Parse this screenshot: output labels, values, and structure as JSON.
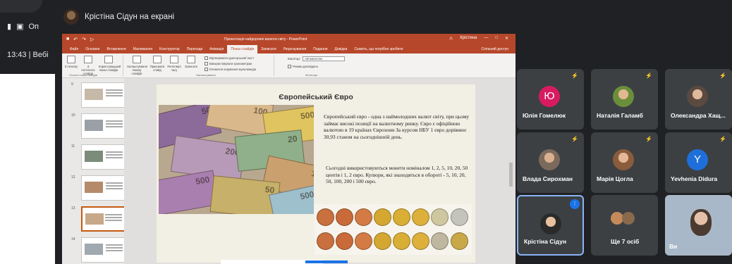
{
  "background_window": {
    "pin_label": "Оп",
    "time": "13:43",
    "separator": "|",
    "meeting_name": "Вебі"
  },
  "presentation_bar": {
    "label": "Крістіна Сідун на екрані"
  },
  "powerpoint": {
    "title": "Презентація найдорожчі валюти світу - PowerPoint",
    "user": "Крістина",
    "share": "Спільний доступ",
    "tabs": [
      "Файл",
      "Основне",
      "Вставлення",
      "Малювання",
      "Конструктор",
      "Переходи",
      "Анімація",
      "Показ слайдів",
      "Записати",
      "Рецензування",
      "Подання",
      "Довідка"
    ],
    "active_tab": "Показ слайдів",
    "help": "Скажіть, що потрібно зробити",
    "ribbon": {
      "buttons": [
        "З початку",
        "З поточного слайда",
        "Користувацький показ слайдів",
        "Налаштування показу слайдів",
        "Приховати слайд",
        "Репетиція часу",
        "Записати"
      ],
      "group1": "Почати показ слайдів",
      "group2": "Налаштування",
      "group3": "Монітори",
      "checks": [
        "Відтворювати дикторський текст",
        "Використовувати хронометраж",
        "Елементи керування мультимедіа"
      ],
      "monitor_label": "Монітор:",
      "monitor_value": "Автоматично",
      "presenter_view": "Режим доповідача"
    },
    "slide_numbers": [
      "9",
      "10",
      "11",
      "12",
      "13",
      "14"
    ],
    "slide": {
      "title": "Європейський Євро",
      "para1": "Європейський євро - одна з наймолодших валют світу, при цьому займає високі позиції на валютному ринку. Євро є офіційною валютою в 19 країнах Єврозони За курсом НБУ 1 євро дорівнює 30,93 станом на сьогоднішній день.",
      "para2": "Сьогодні використовуються монети номіналом 1, 2, 5, 10, 20, 50 центів і 1, 2 євро. Купюри, які знаходяться в обороті - 5, 10, 20, 50, 100, 200 і 500 євро.",
      "banknotes": [
        "50",
        "100",
        "500",
        "200",
        "20",
        "10",
        "500",
        "50",
        "500",
        "200"
      ]
    }
  },
  "participants": [
    {
      "name": "Юлія Гомелюк",
      "initial": "Ю",
      "color": "#d81b60"
    },
    {
      "name": "Наталія Галамб",
      "initial": "",
      "color": "#6b8e3a"
    },
    {
      "name": "Олександра Хащ...",
      "initial": "",
      "color": "#5a4a40"
    },
    {
      "name": "Влада Сирохман",
      "initial": "",
      "color": "#7b6a5c"
    },
    {
      "name": "Марія Цогла",
      "initial": "",
      "color": "#8a5c3c"
    },
    {
      "name": "Yevhenia Didura",
      "initial": "Y",
      "color": "#1e6fd9"
    },
    {
      "name": "Крістіна Сідун",
      "initial": "",
      "color": "#2a2a2a"
    },
    {
      "name": "Ще 7 осіб",
      "initial": "",
      "color": "#c48a5a"
    },
    {
      "name": "Ви",
      "initial": "",
      "color": "#a9b8c8"
    }
  ]
}
